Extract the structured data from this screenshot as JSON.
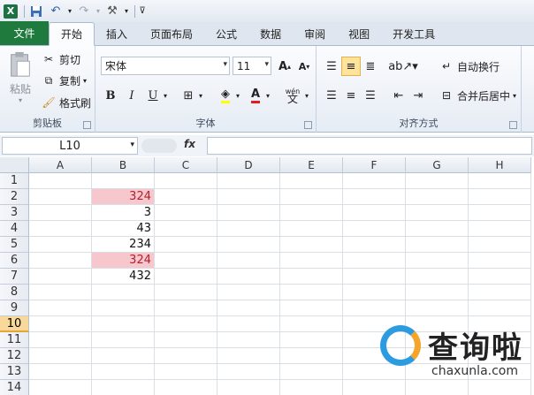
{
  "titlebar": {
    "app_icon": "X"
  },
  "tabs": [
    {
      "label": "文件"
    },
    {
      "label": "开始"
    },
    {
      "label": "插入"
    },
    {
      "label": "页面布局"
    },
    {
      "label": "公式"
    },
    {
      "label": "数据"
    },
    {
      "label": "审阅"
    },
    {
      "label": "视图"
    },
    {
      "label": "开发工具"
    }
  ],
  "ribbon": {
    "clipboard": {
      "label": "剪贴板",
      "paste": "粘贴",
      "cut": "剪切",
      "copy": "复制",
      "format_painter": "格式刷"
    },
    "font": {
      "label": "字体",
      "font_name": "宋体",
      "font_size": "11",
      "grow": "A",
      "shrink": "A",
      "bold": "B",
      "italic": "I",
      "underline": "U",
      "font_color": "A",
      "phonetic": "wén"
    },
    "alignment": {
      "label": "对齐方式",
      "wrap_text": "自动换行",
      "merge_center": "合并后居中"
    }
  },
  "formula_bar": {
    "name_box": "L10",
    "fx": "fx",
    "value": ""
  },
  "grid": {
    "columns": [
      "A",
      "B",
      "C",
      "D",
      "E",
      "F",
      "G",
      "H"
    ],
    "rows": [
      "1",
      "2",
      "3",
      "4",
      "5",
      "6",
      "7",
      "8",
      "9",
      "10",
      "11",
      "12",
      "13",
      "14"
    ],
    "active_row": "10",
    "b_values": [
      "",
      "324",
      "3",
      "43",
      "234",
      "324",
      "432",
      "",
      "",
      "",
      "",
      "",
      "",
      ""
    ],
    "highlight_rows": [
      "2",
      "6"
    ],
    "highlight_color": "#f6c8cd"
  },
  "watermark": {
    "brand": "查询啦",
    "url": "chaxunla.com"
  }
}
